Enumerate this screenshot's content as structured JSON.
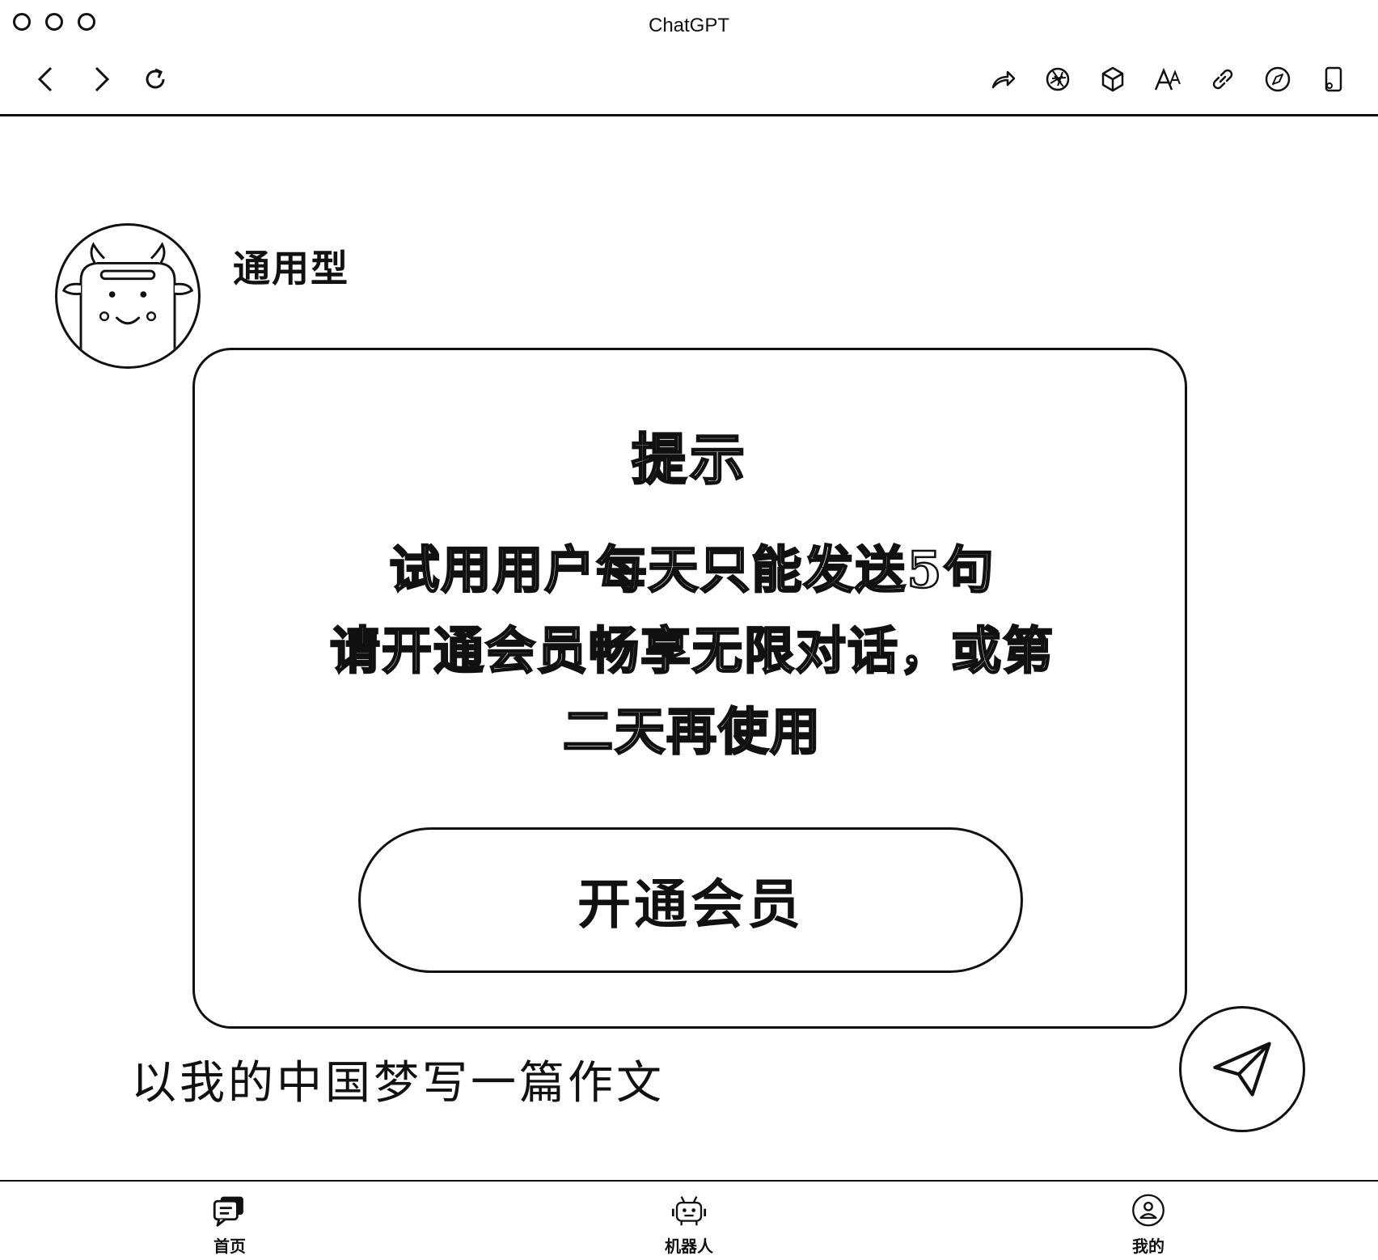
{
  "window": {
    "title": "ChatGPT"
  },
  "toolbar": {
    "icons": [
      "back-icon",
      "forward-icon",
      "reload-icon",
      "share-icon",
      "aperture-icon",
      "cube-icon",
      "text-size-icon",
      "link-icon",
      "compass-icon",
      "phone-icon"
    ]
  },
  "bot": {
    "name": "通用型"
  },
  "dialog": {
    "title": "提示",
    "message_line1": "试用用户每天只能发送5句",
    "message_line2": "请开通会员畅享无限对话，或第",
    "message_line3": "二天再使用",
    "button_label": "开通会员"
  },
  "input": {
    "value": "以我的中国梦写一篇作文"
  },
  "bottom_nav": [
    {
      "label": "首页",
      "icon": "chat-icon"
    },
    {
      "label": "机器人",
      "icon": "robot-icon"
    },
    {
      "label": "我的",
      "icon": "user-icon"
    }
  ]
}
